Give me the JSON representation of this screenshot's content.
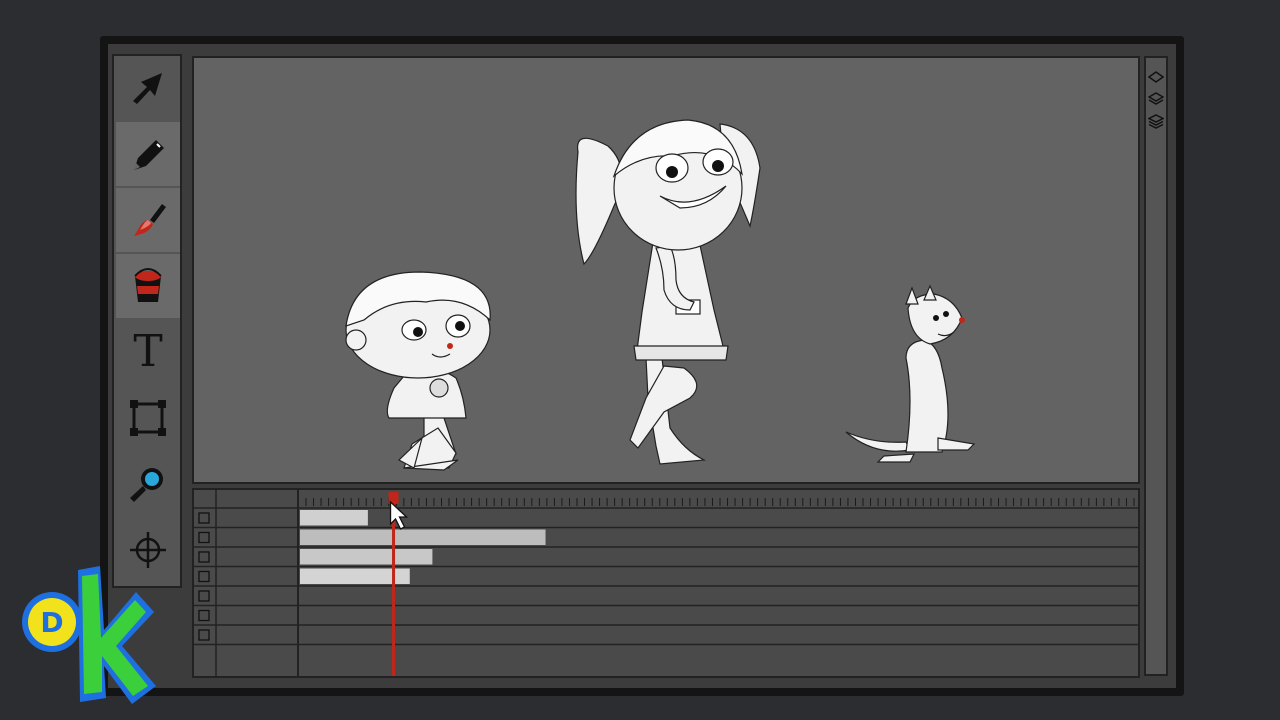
{
  "app": {
    "title": "",
    "logo_letters": "DK"
  },
  "tools": [
    {
      "name": "select-arrow-tool",
      "icon": "arrow-icon",
      "active": false
    },
    {
      "name": "pencil-tool",
      "icon": "pencil-icon",
      "active": true
    },
    {
      "name": "brush-tool",
      "icon": "brush-icon",
      "active": true
    },
    {
      "name": "paint-bucket-tool",
      "icon": "paint-bucket-icon",
      "active": true
    },
    {
      "name": "text-tool",
      "icon": "text-icon",
      "active": false,
      "glyph": "T"
    },
    {
      "name": "transform-tool",
      "icon": "transform-box-icon",
      "active": false
    },
    {
      "name": "zoom-tool",
      "icon": "magnifier-icon",
      "active": false
    },
    {
      "name": "target-tool",
      "icon": "crosshair-icon",
      "active": false
    }
  ],
  "layer_panel": {
    "icons": [
      "single-layer-icon",
      "two-layers-icon",
      "three-layers-icon"
    ]
  },
  "timeline": {
    "track_count": 8,
    "playhead_frame_fraction": 0.114,
    "clips": [
      {
        "track": 1,
        "start": 0.0,
        "end": 0.081,
        "color": "#d0d0d0"
      },
      {
        "track": 2,
        "start": 0.0,
        "end": 0.293,
        "color": "#bdbdbd"
      },
      {
        "track": 3,
        "start": 0.0,
        "end": 0.158,
        "color": "#c8c8c8"
      },
      {
        "track": 4,
        "start": 0.0,
        "end": 0.131,
        "color": "#d4d4d4"
      }
    ]
  },
  "colors": {
    "accent": "#c0261a",
    "logo_blue": "#1e6fe0",
    "logo_green": "#3bd03b",
    "logo_yellow": "#f2e21b"
  }
}
